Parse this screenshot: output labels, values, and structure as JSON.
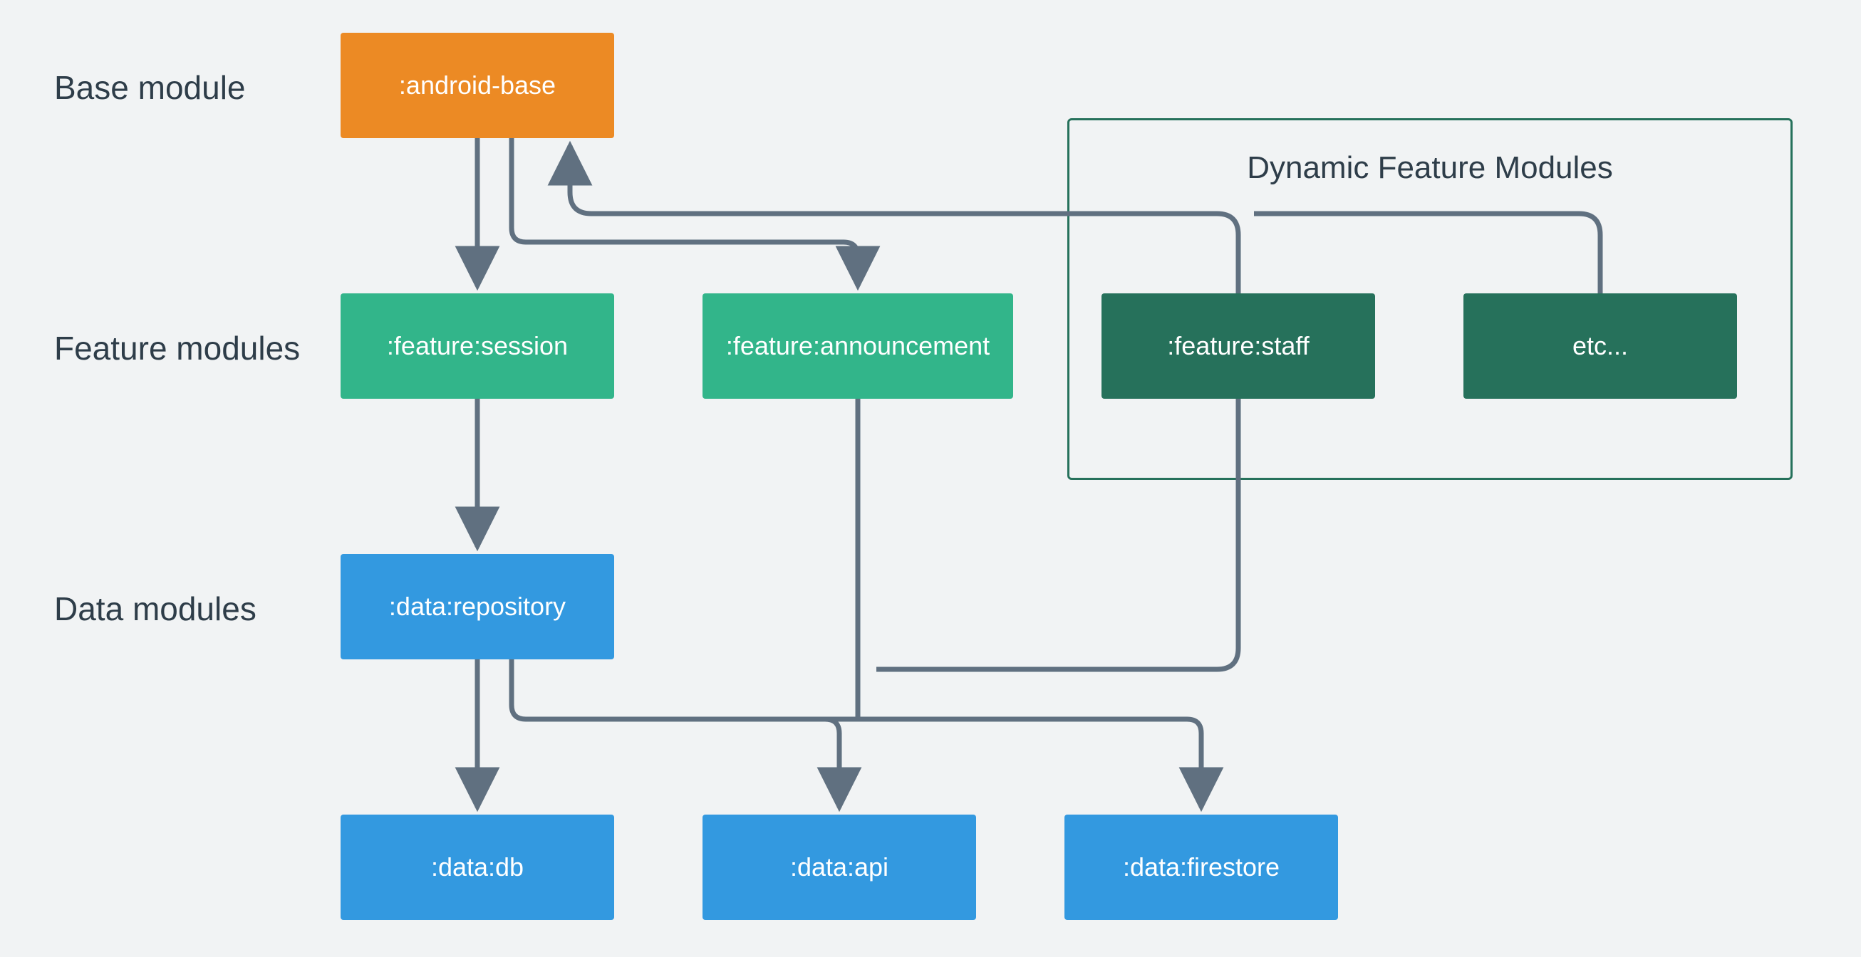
{
  "labels": {
    "row_base": "Base module",
    "row_feature": "Feature modules",
    "row_data": "Data modules",
    "group_dynamic": "Dynamic Feature Modules"
  },
  "nodes": {
    "android_base": ":android-base",
    "feature_session": ":feature:session",
    "feature_announcement": ":feature:announcement",
    "feature_staff": ":feature:staff",
    "feature_etc": "etc...",
    "data_repository": ":data:repository",
    "data_db": ":data:db",
    "data_api": ":data:api",
    "data_firestore": ":data:firestore"
  },
  "colors": {
    "orange": "#ec8a24",
    "teal": "#32b58a",
    "dark_teal": "#26715b",
    "blue": "#3399e0",
    "edge": "#607080",
    "bg": "#f1f3f4"
  },
  "chart_data": {
    "type": "diagram",
    "title": "Module dependency diagram",
    "rows": [
      {
        "name": "Base module",
        "modules": [
          ":android-base"
        ]
      },
      {
        "name": "Feature modules",
        "modules": [
          ":feature:session",
          ":feature:announcement",
          ":feature:staff",
          "etc..."
        ]
      },
      {
        "name": "Data modules",
        "modules": [
          ":data:repository",
          ":data:db",
          ":data:api",
          ":data:firestore"
        ]
      }
    ],
    "dynamic_feature_modules": [
      ":feature:staff",
      "etc..."
    ],
    "edges": [
      {
        "from": ":android-base",
        "to": ":feature:session"
      },
      {
        "from": ":android-base",
        "to": ":feature:announcement"
      },
      {
        "from": ":feature:staff",
        "to": ":android-base"
      },
      {
        "from": "etc...",
        "to": ":android-base"
      },
      {
        "from": ":feature:session",
        "to": ":data:repository"
      },
      {
        "from": ":feature:announcement",
        "to": ":data:api"
      },
      {
        "from": ":feature:staff",
        "to": ":data:firestore"
      },
      {
        "from": ":data:repository",
        "to": ":data:db"
      },
      {
        "from": ":data:repository",
        "to": ":data:api"
      },
      {
        "from": ":data:repository",
        "to": ":data:firestore"
      }
    ]
  }
}
